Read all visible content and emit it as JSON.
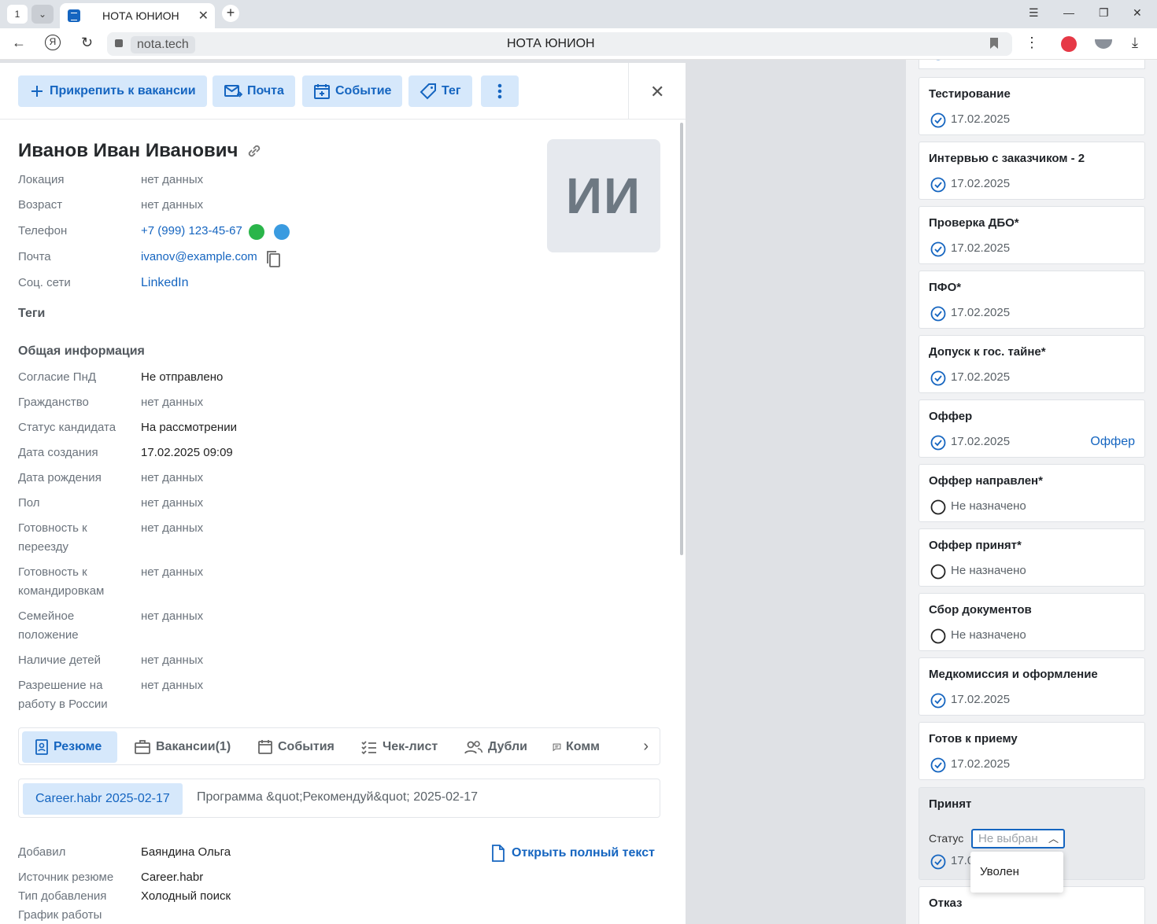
{
  "browser": {
    "tab_count": "1",
    "tab_title": "НОТА ЮНИОН",
    "url_host": "nota.tech",
    "page_title": "НОТА ЮНИОН"
  },
  "toolbar": {
    "attach": "Прикрепить к вакансии",
    "mail": "Почта",
    "event": "Событие",
    "tag": "Тег"
  },
  "candidate": {
    "name": "Иванов Иван Иванович",
    "initials": "ИИ",
    "fields": [
      {
        "label": "Локация",
        "value": "нет данных"
      },
      {
        "label": "Возраст",
        "value": "нет данных"
      },
      {
        "label": "Телефон",
        "value": "+7 (999) 123-45-67"
      },
      {
        "label": "Почта",
        "value": "ivanov@example.com"
      },
      {
        "label": "Соц. сети",
        "value": "LinkedIn"
      }
    ],
    "tags_title": "Теги",
    "general_title": "Общая информация",
    "general": [
      {
        "label": "Согласие ПнД",
        "value": "Не отправлено"
      },
      {
        "label": "Гражданство",
        "value": "нет данных"
      },
      {
        "label": "Статус кандидата",
        "value": "На рассмотрении"
      },
      {
        "label": "Дата создания",
        "value": "17.02.2025 09:09"
      },
      {
        "label": "Дата рождения",
        "value": "нет данных"
      },
      {
        "label": "Пол",
        "value": "нет данных"
      },
      {
        "label": "Готовность к",
        "label2": "переезду",
        "value": "нет данных"
      },
      {
        "label": "Готовность к",
        "label2": "командировкам",
        "value": "нет данных"
      },
      {
        "label": "Семейное",
        "label2": "положение",
        "value": "нет данных"
      },
      {
        "label": "Наличие детей",
        "value": "нет данных"
      },
      {
        "label": "Разрешение на",
        "label2": "работу в России",
        "value": "нет данных"
      }
    ]
  },
  "tabs": [
    "Резюме",
    "Вакансии(1)",
    "События",
    "Чек-лист",
    "Дубли",
    "Комм"
  ],
  "sources": {
    "active": "Career.habr 2025-02-17",
    "other": "Программа &quot;Рекомендуй&quot; 2025-02-17"
  },
  "resume": {
    "open_full": "Открыть полный текст",
    "rows": [
      {
        "label": "Добавил",
        "value": "Баяндина Ольга"
      },
      {
        "label": "Источник резюме",
        "value": "Career.habr"
      },
      {
        "label": "Тип добавления",
        "value": "Холодный поиск"
      },
      {
        "label": "График работы",
        "value": ""
      }
    ]
  },
  "stages": [
    {
      "title": "Тестирование",
      "date": "17.02.2025",
      "done": true
    },
    {
      "title": "Интервью с заказчиком - 2",
      "date": "17.02.2025",
      "done": true
    },
    {
      "title": "Проверка ДБО*",
      "date": "17.02.2025",
      "done": true
    },
    {
      "title": "ПФО*",
      "date": "17.02.2025",
      "done": true
    },
    {
      "title": "Допуск к гос. тайне*",
      "date": "17.02.2025",
      "done": true
    },
    {
      "title": "Оффер",
      "date": "17.02.2025",
      "done": true,
      "link": "Оффер"
    },
    {
      "title": "Оффер направлен*",
      "date": "Не назначено",
      "done": false
    },
    {
      "title": "Оффер принят*",
      "date": "Не назначено",
      "done": false
    },
    {
      "title": "Сбор документов",
      "date": "Не назначено",
      "done": false
    },
    {
      "title": "Медкомиссия и оформление",
      "date": "17.02.2025",
      "done": true
    },
    {
      "title": "Готов к приему",
      "date": "17.02.2025",
      "done": true
    }
  ],
  "selected_stage": {
    "title": "Принят",
    "status_label": "Статус",
    "status_placeholder": "Не выбран",
    "date_partial": "17.0",
    "dropdown_option": "Уволен"
  },
  "last_stage": {
    "title": "Отказ"
  },
  "colors": {
    "accent": "#1565c0",
    "accent_bg": "#d6e8fb"
  }
}
